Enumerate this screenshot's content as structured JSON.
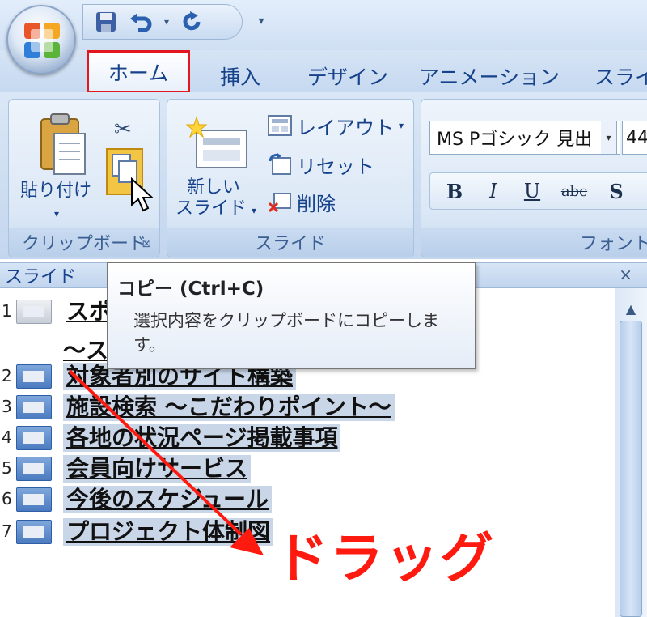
{
  "quick_access": {
    "save_icon": "save-icon",
    "undo_icon": "undo-icon",
    "undo_arrow": "▾",
    "redo_icon": "redo-icon",
    "customize": "▾"
  },
  "tabs": [
    {
      "label": "ホーム",
      "active": true
    },
    {
      "label": "挿入"
    },
    {
      "label": "デザイン"
    },
    {
      "label": "アニメーション"
    },
    {
      "label": "スライ"
    }
  ],
  "ribbon": {
    "clipboard": {
      "paste_label": "貼り付け",
      "paste_arrow": "▾",
      "group_label": "クリップボード",
      "launcher": "⊠"
    },
    "slides": {
      "new_slide_label_1": "新しい",
      "new_slide_label_2": "スライド",
      "new_slide_arrow": "▾",
      "layout_label": "レイアウト",
      "layout_arrow": "▾",
      "reset_label": "リセット",
      "delete_label": "削除",
      "group_label": "スライド"
    },
    "font": {
      "font_name": "MS Pゴシック 見出",
      "font_drop": "▾",
      "font_size": "44",
      "bold": "B",
      "italic": "I",
      "underline": "U",
      "strike": "abc",
      "shadow": "S",
      "group_label": "フォント"
    }
  },
  "slides_pane": {
    "tab_label": "スライド",
    "close": "×",
    "scroll_up": "▲",
    "rows": [
      {
        "num": "1",
        "title": "スポ"
      },
      {
        "num": "2",
        "title": "対象者別のサイト構築"
      },
      {
        "num": "3",
        "title": "施設検索 ～こだわりポイント～"
      },
      {
        "num": "4",
        "title": "各地の状況ページ掲載事項"
      },
      {
        "num": "5",
        "title": "会員向けサービス"
      },
      {
        "num": "6",
        "title": "今後のスケジュール"
      },
      {
        "num": "7",
        "title": "プロジェクト体制図"
      }
    ],
    "row1_line2": "～ス"
  },
  "tooltip": {
    "title": "コピー (Ctrl+C)",
    "body": "選択内容をクリップボードにコピーします。"
  },
  "annotation": {
    "label": "ドラッグ",
    "color": "#ff1a10"
  },
  "colors": {
    "accent": "#15428b",
    "highlight_border": "#e3181f"
  }
}
